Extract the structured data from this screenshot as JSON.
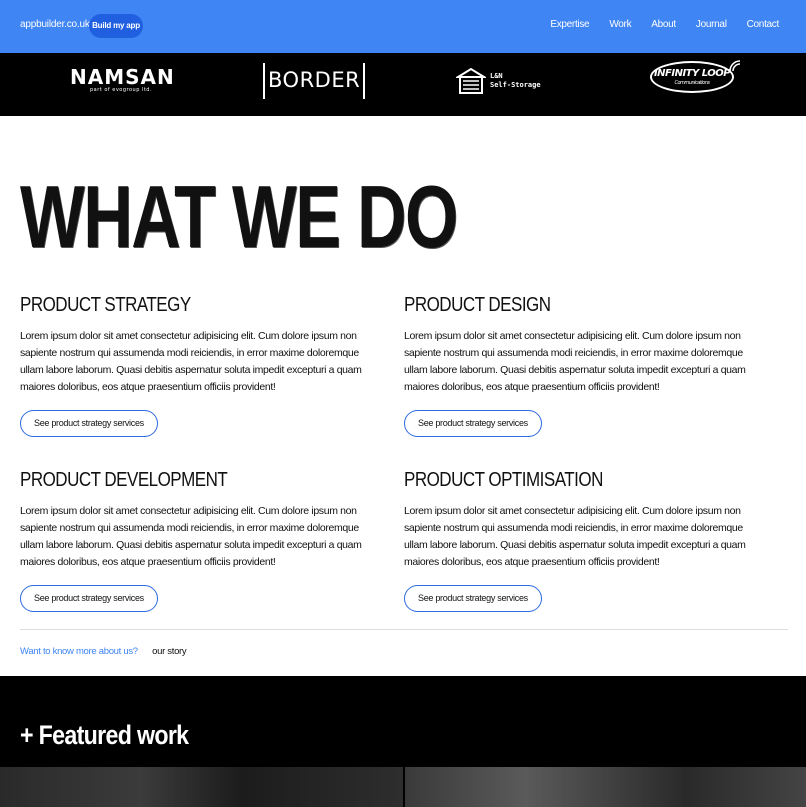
{
  "header": {
    "brand": "appbuilder.co.uk",
    "cta": "Build my app",
    "nav": [
      "Expertise",
      "Work",
      "About",
      "Journal",
      "Contact"
    ]
  },
  "clients": {
    "namsan": {
      "name": "NAMSAN",
      "tagline": "part of evogroup ltd."
    },
    "border": {
      "name": "BORDER"
    },
    "storage": {
      "line1": "L&N",
      "line2": "Self-Storage"
    },
    "infinity": {
      "name": "INFINITY LOOP",
      "tagline": "Communications"
    }
  },
  "hero": {
    "title": "WHAT WE DO"
  },
  "services": [
    {
      "title": "PRODUCT STRATEGY",
      "body": "Lorem ipsum dolor sit amet consectetur adipisicing elit. Cum dolore ipsum non sapiente nostrum qui assumenda modi reiciendis, in error maxime doloremque ullam labore laborum. Quasi debitis aspernatur soluta impedit excepturi a quam maiores doloribus, eos atque praesentium officiis provident!",
      "button": "See product strategy services"
    },
    {
      "title": "PRODUCT DESIGN",
      "body": "Lorem ipsum dolor sit amet consectetur adipisicing elit. Cum dolore ipsum non sapiente nostrum qui assumenda modi reiciendis, in error maxime doloremque ullam labore laborum. Quasi debitis aspernatur soluta impedit excepturi a quam maiores doloribus, eos atque praesentium officiis provident!",
      "button": "See product strategy services"
    },
    {
      "title": "PRODUCT DEVELOPMENT",
      "body": "Lorem ipsum dolor sit amet consectetur adipisicing elit. Cum dolore ipsum non sapiente nostrum qui assumenda modi reiciendis, in error maxime doloremque ullam labore laborum. Quasi debitis aspernatur soluta impedit excepturi a quam maiores doloribus, eos atque praesentium officiis provident!",
      "button": "See product strategy services"
    },
    {
      "title": "PRODUCT OPTIMISATION",
      "body": "Lorem ipsum dolor sit amet consectetur adipisicing elit. Cum dolore ipsum non sapiente nostrum qui assumenda modi reiciendis, in error maxime doloremque ullam labore laborum. Quasi debitis aspernatur soluta impedit excepturi a quam maiores doloribus, eos atque praesentium officiis provident!",
      "button": "See product strategy services"
    }
  ],
  "more": {
    "question": "Want to know more about us?",
    "link": "our story"
  },
  "featured": {
    "title": "+ Featured work"
  },
  "colors": {
    "accent": "#3f85f4",
    "cta": "#1f5fe0",
    "dark": "#000000"
  }
}
